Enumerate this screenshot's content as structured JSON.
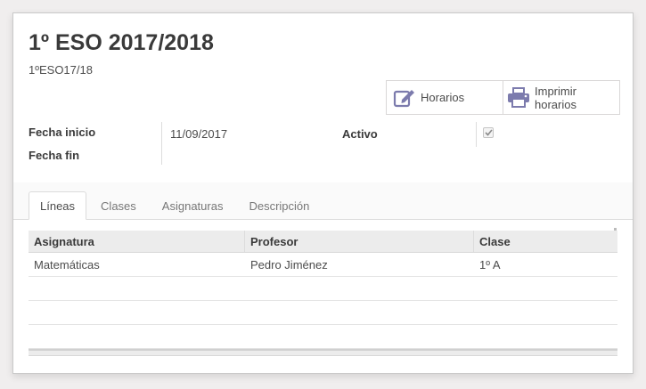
{
  "record": {
    "title": "1º ESO 2017/2018",
    "code": "1ºESO17/18"
  },
  "buttons": {
    "schedules_label": "Horarios",
    "print_schedules_label": "Imprimir horarios"
  },
  "fields": {
    "start_label": "Fecha inicio",
    "start_value": "11/09/2017",
    "end_label": "Fecha fin",
    "end_value": "",
    "active_label": "Activo",
    "active_checked": true
  },
  "tabs": [
    {
      "label": "Líneas",
      "active": true
    },
    {
      "label": "Clases",
      "active": false
    },
    {
      "label": "Asignaturas",
      "active": false
    },
    {
      "label": "Descripción",
      "active": false
    }
  ],
  "lines_table": {
    "headers": [
      "Asignatura",
      "Profesor",
      "Clase"
    ],
    "rows": [
      [
        "Matemáticas",
        "Pedro Jiménez",
        "1º A"
      ]
    ]
  },
  "colors": {
    "icon": "#7c7bad",
    "background": "#f0eeee"
  },
  "icons": {
    "schedules": "edit-icon",
    "print": "print-icon",
    "checkbox": "check-icon"
  }
}
